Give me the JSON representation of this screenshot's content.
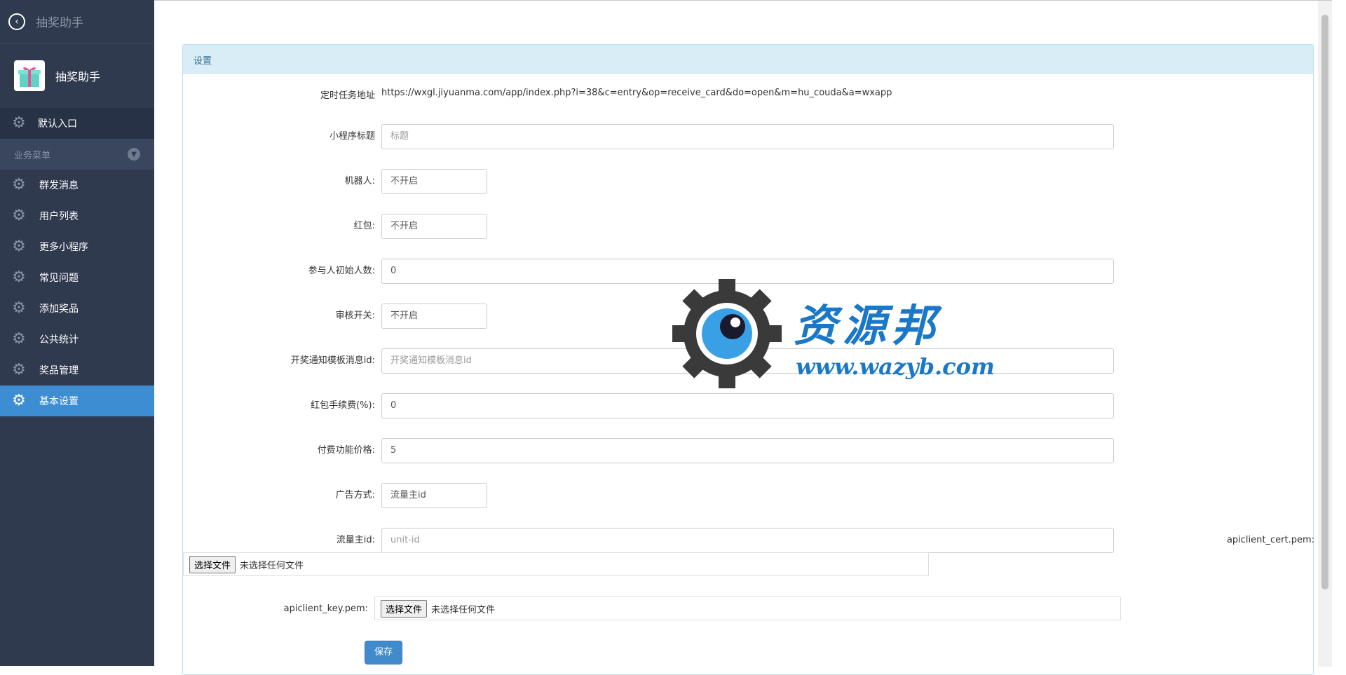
{
  "sidebar": {
    "top_title": "抽奖助手",
    "app_name": "抽奖助手",
    "default_entry": "默认入口",
    "group_label": "业务菜单",
    "items": [
      {
        "label": "群发消息"
      },
      {
        "label": "用户列表"
      },
      {
        "label": "更多小程序"
      },
      {
        "label": "常见问题"
      },
      {
        "label": "添加奖品"
      },
      {
        "label": "公共统计"
      },
      {
        "label": "奖品管理"
      },
      {
        "label": "基本设置",
        "active": true
      }
    ]
  },
  "panel": {
    "heading": "设置"
  },
  "form": {
    "task_url_label": "定时任务地址",
    "task_url_value": "https://wxgl.jiyuanma.com/app/index.php?i=38&c=entry&op=receive_card&do=open&m=hu_couda&a=wxapp",
    "title_label": "小程序标题",
    "title_placeholder": "标题",
    "robot_label": "机器人:",
    "robot_value": "不开启",
    "redpack_label": "红包:",
    "redpack_value": "不开启",
    "initial_count_label": "参与人初始人数:",
    "initial_count_value": "0",
    "review_label": "审核开关:",
    "review_value": "不开启",
    "template_label": "开奖通知模板消息id:",
    "template_placeholder": "开奖通知模板消息id",
    "fee_label": "红包手续费(%):",
    "fee_value": "0",
    "price_label": "付费功能价格:",
    "price_value": "5",
    "ad_mode_label": "广告方式:",
    "ad_mode_value": "流量主id",
    "unit_id_label": "流量主id:",
    "unit_id_placeholder": "unit-id",
    "cert_label": "apiclient_cert.pem:",
    "key_label": "apiclient_key.pem:",
    "choose_file": "选择文件",
    "no_file": "未选择任何文件",
    "save_label": "保存"
  },
  "watermark": {
    "text": "资源邦",
    "url": "www.wazyb.com"
  },
  "colors": {
    "sidebar_bg": "#2f3a4f",
    "active_bg": "#3d8dd3",
    "panel_head_bg": "#d9edf7",
    "primary_button": "#428bca"
  }
}
